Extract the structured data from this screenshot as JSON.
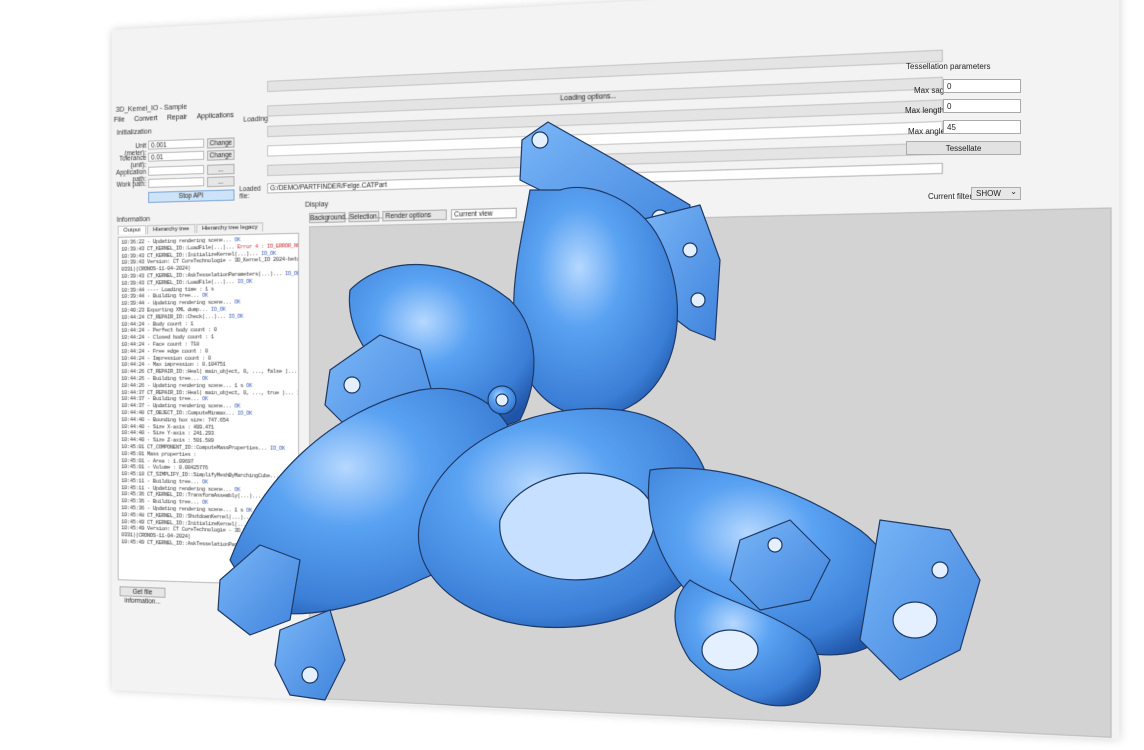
{
  "window": {
    "title": "3D_Kernel_IO - Sample",
    "controls": {
      "minimize": "—",
      "restore": "❐",
      "close": "✕"
    },
    "menu": [
      "File",
      "Convert",
      "Repair",
      "Applications"
    ]
  },
  "initialization": {
    "title": "Initialization",
    "unit_label": "Unit (meter):",
    "unit_value": "0.001",
    "unit_button": "Change",
    "tolerance_label": "Tolerance (unit):",
    "tolerance_value": "0.01",
    "tolerance_button": "Change",
    "app_path_label": "Application path:",
    "app_path_button": "...",
    "work_path_label": "Work path:",
    "work_path_button": "...",
    "stop_api": "Stop API"
  },
  "loading": {
    "title": "Loading",
    "options_button": "Loading options...",
    "loaded_file_label": "Loaded file:",
    "loaded_file_value": "G:/DEMO/PARTFINDER/Felge.CATPart"
  },
  "information": {
    "title": "Information",
    "tabs": [
      "Output",
      "Hierarchy tree",
      "Hierarchy tree legacy"
    ],
    "get_file_info": "Get file information..."
  },
  "log_lines": [
    {
      "t": "10:36:22  - Updating rendering scene... ",
      "s": "OK",
      "c": "ok"
    },
    {
      "t": "10:39:43  CT_KERNEL_IO::LoadFile(...)... ",
      "s": "Error 4 : IO_ERROR_NOT_INITIALIZED",
      "c": "err"
    },
    {
      "t": "10:39:43  CT_KERNEL_IO::InitializeKernel(...)... ",
      "s": "IO_OK",
      "c": "ok"
    },
    {
      "t": "10:39:43  Version: CT CoreTechnologie - 3D_Kernel_IO 2024-beta (Windows 64)(build:",
      "s": "",
      "c": ""
    },
    {
      "t": "0331)(CRONOS-11-04-2024)",
      "s": "",
      "c": ""
    },
    {
      "t": "10:39:43  CT_KERNEL_IO::AskTesselationParameters(...)... ",
      "s": "IO_OK",
      "c": "ok"
    },
    {
      "t": "10:39:43  CT_KERNEL_IO::LoadFile(...)... ",
      "s": "IO_OK",
      "c": "ok"
    },
    {
      "t": "10:39:44  ---- Loading time : 1 s",
      "s": "",
      "c": ""
    },
    {
      "t": "10:39:44  - Building tree... ",
      "s": "OK",
      "c": "ok"
    },
    {
      "t": "10:39:44  - Updating rendering scene... ",
      "s": "OK",
      "c": "ok"
    },
    {
      "t": "10:40:23  Exporting XML dump... ",
      "s": "IO_OK",
      "c": "ok"
    },
    {
      "t": "10:44:24  CT_REPAIR_IO::Check(...)... ",
      "s": "IO_OK",
      "c": "ok"
    },
    {
      "t": "10:44:24  - Body count        : 1",
      "s": "",
      "c": ""
    },
    {
      "t": "10:44:24  - Perfect body count : 0",
      "s": "",
      "c": ""
    },
    {
      "t": "10:44:24  - Closed body count          : 1",
      "s": "",
      "c": ""
    },
    {
      "t": "10:44:24  - Face count          : 718",
      "s": "",
      "c": ""
    },
    {
      "t": "10:44:24  - Free edge count     : 0",
      "s": "",
      "c": ""
    },
    {
      "t": "10:44:24  - Impression count : 0",
      "s": "",
      "c": ""
    },
    {
      "t": "10:44:24  - Max impression   : 0.104751",
      "s": "",
      "c": ""
    },
    {
      "t": "10:44:26  CT_REPAIR_IO::Heal( main_object, 0, ..., false )... ",
      "s": "IO_OK",
      "c": "ok"
    },
    {
      "t": "10:44:26  - Building tree... ",
      "s": "OK",
      "c": "ok"
    },
    {
      "t": "10:44:26  - Updating rendering scene... 1 s ",
      "s": "OK",
      "c": "ok"
    },
    {
      "t": "10:44:37  CT_REPAIR_IO::Heal( main_object, 0, ..., true )... ",
      "s": "IO_OK",
      "c": "ok"
    },
    {
      "t": "10:44:37  - Building tree... ",
      "s": "OK",
      "c": "ok"
    },
    {
      "t": "10:44:37  - Updating rendering scene... ",
      "s": "OK",
      "c": "ok"
    },
    {
      "t": "10:44:40  CT_OBJECT_IO::ComputeMinmax... ",
      "s": "IO_OK",
      "c": "ok"
    },
    {
      "t": "10:44:40  - Bounding box size: 747.654",
      "s": "",
      "c": ""
    },
    {
      "t": "10:44:40  - Size X-axis       : 499.471",
      "s": "",
      "c": ""
    },
    {
      "t": "10:44:40  - Size Y-axis       : 241.293",
      "s": "",
      "c": ""
    },
    {
      "t": "10:44:40  - Size Z-axis       : 501.589",
      "s": "",
      "c": ""
    },
    {
      "t": "10:45:01  CT_COMPONENT_IO::ComputeMassProperties... ",
      "s": "IO_OK",
      "c": "ok"
    },
    {
      "t": "10:45:01  Mass properties :",
      "s": "",
      "c": ""
    },
    {
      "t": "10:45:01  - Area  : 1.09697",
      "s": "",
      "c": ""
    },
    {
      "t": "10:45:01  - Volume : 0.00425776",
      "s": "",
      "c": ""
    },
    {
      "t": "10:45:10  CT_SIMPLIFY_IO::SimplifyMeshByMarchingCube... ",
      "s": "IO_OK",
      "c": "ok"
    },
    {
      "t": "10:45:11  - Building tree... ",
      "s": "OK",
      "c": "ok"
    },
    {
      "t": "10:45:11  - Updating rendering scene... ",
      "s": "OK",
      "c": "ok"
    },
    {
      "t": "10:45:36  CT_KERNEL_IO::TransformAssembly(...)... ",
      "s": "IO_OK",
      "c": "ok"
    },
    {
      "t": "10:45:36  - Building tree... ",
      "s": "OK",
      "c": "ok"
    },
    {
      "t": "10:45:36  - Updating rendering scene... 1 s ",
      "s": "OK",
      "c": "ok"
    },
    {
      "t": "10:45:48  CT_KERNEL_IO::ShutdownKernel(...)... ",
      "s": "IO_OK",
      "c": "ok"
    },
    {
      "t": "10:45:49  CT_KERNEL_IO::InitializeKernel(...)... ",
      "s": "IO_OK",
      "c": "ok"
    },
    {
      "t": "10:45:49  Version: CT CoreTechnologie - 3D_Kernel_IO 2024-beta (Windows 64)(build:",
      "s": "",
      "c": ""
    },
    {
      "t": "0331)(CRONOS-11-04-2024)",
      "s": "",
      "c": ""
    },
    {
      "t": "10:45:49  CT_KERNEL_IO::AskTesselationParameters(...)... ",
      "s": "IO_OK",
      "c": "ok"
    }
  ],
  "display": {
    "title": "Display",
    "background_button": "Background...",
    "selection_button": "Selection...",
    "render_options": "Render options",
    "current_view": "Current view"
  },
  "tessellation": {
    "title": "Tessellation parameters",
    "max_sag_label": "Max sag:",
    "max_sag_value": "0",
    "max_length_label": "Max length:",
    "max_length_value": "0",
    "max_angle_label": "Max angle:",
    "max_angle_value": "45",
    "tessellate_button": "Tessellate"
  },
  "filter": {
    "label": "Current filter:",
    "value": "SHOW",
    "arrow": "⌄"
  },
  "model": {
    "color": "#4a93ea",
    "edge_color": "#1f3a66"
  }
}
